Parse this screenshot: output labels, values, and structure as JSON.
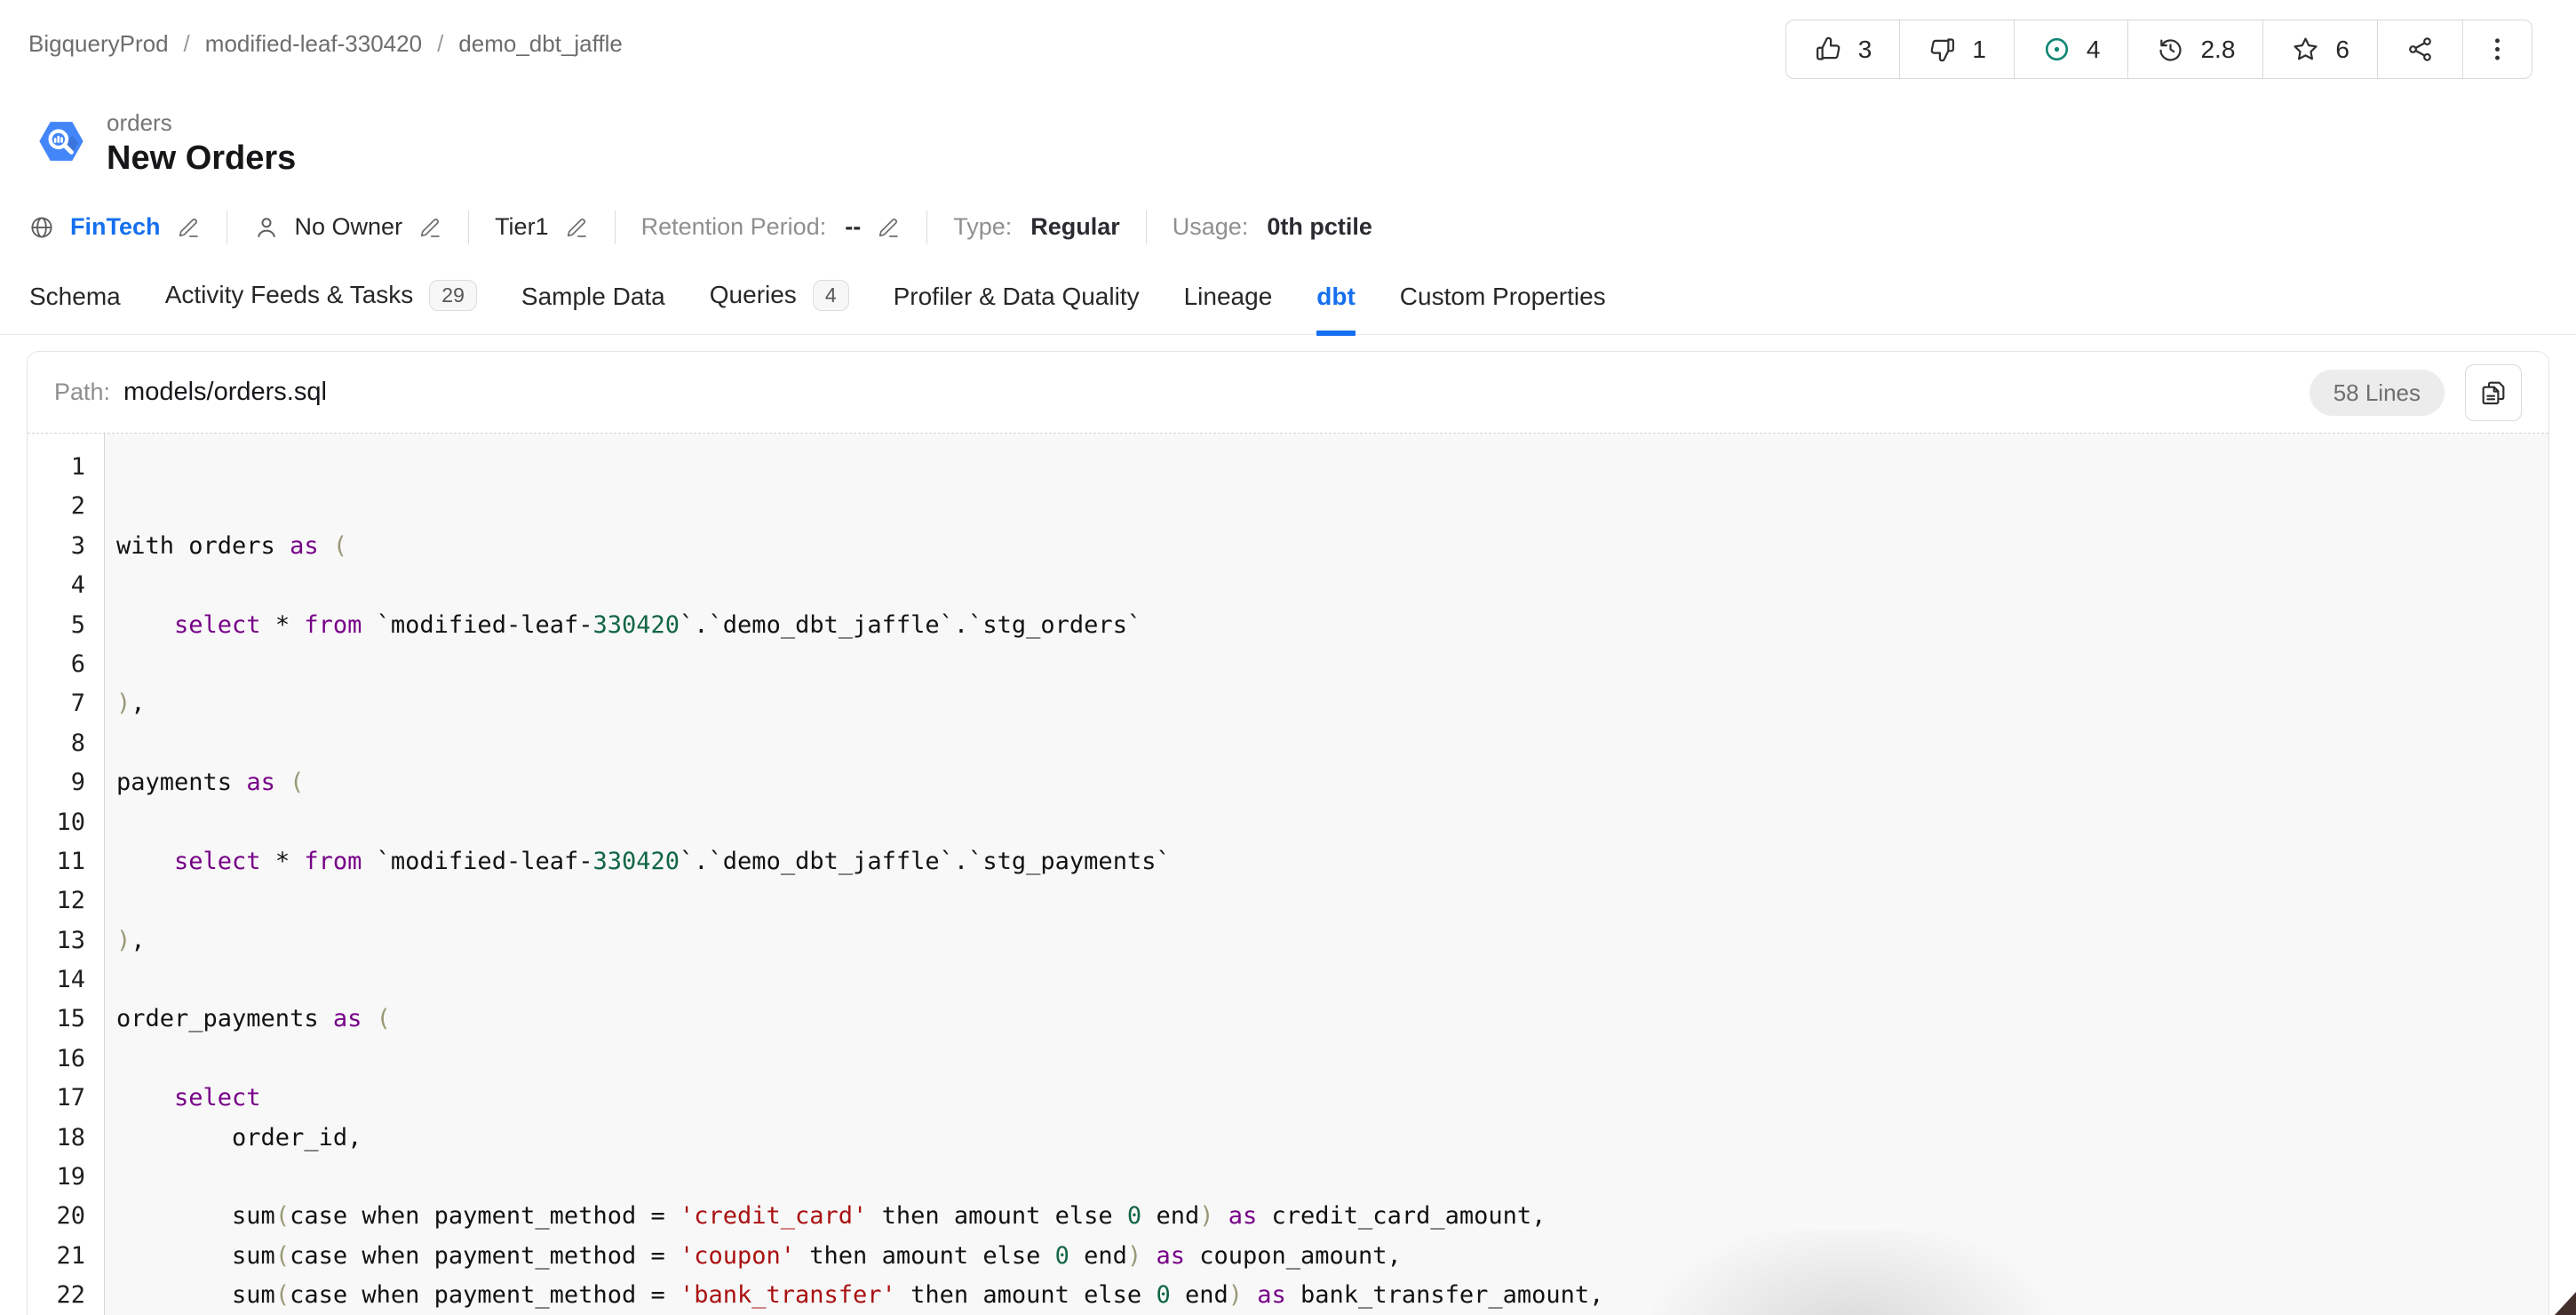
{
  "colors": {
    "accent": "#1570ef",
    "sql_keyword": "#770088",
    "sql_number": "#116644",
    "sql_string": "#aa1111",
    "sql_bracket": "#999977",
    "task_icon": "#0e8673",
    "bigquery_blue": "#4386fa"
  },
  "breadcrumb": {
    "separator": "/",
    "items": [
      "BigqueryProd",
      "modified-leaf-330420",
      "demo_dbt_jaffle"
    ]
  },
  "header": {
    "actions": [
      {
        "name": "upvote",
        "icon": "thumb-up-icon",
        "count": "3"
      },
      {
        "name": "downvote",
        "icon": "thumb-down-icon",
        "count": "1"
      },
      {
        "name": "tasks",
        "icon": "circle-dot-icon",
        "count": "4"
      },
      {
        "name": "version",
        "icon": "history-icon",
        "count": "2.8"
      },
      {
        "name": "follow",
        "icon": "star-icon",
        "count": "6"
      },
      {
        "name": "share",
        "icon": "share-icon"
      },
      {
        "name": "more",
        "icon": "kebab-icon"
      }
    ]
  },
  "entity": {
    "icon": "bigquery-icon",
    "type_label": "orders",
    "title": "New Orders"
  },
  "meta": {
    "items": [
      {
        "name": "domain",
        "icon": "globe-icon",
        "text": "FinTech",
        "link": true,
        "editable": true
      },
      {
        "name": "owner",
        "icon": "user-icon",
        "text": "No Owner",
        "editable": true
      },
      {
        "name": "tier",
        "text": "Tier1",
        "editable": true
      },
      {
        "name": "retention",
        "label": "Retention Period:",
        "value": "--",
        "editable": true
      },
      {
        "name": "type",
        "label": "Type:",
        "value": "Regular"
      },
      {
        "name": "usage",
        "label": "Usage:",
        "value": "0th pctile"
      }
    ]
  },
  "tabs": {
    "items": [
      {
        "label": "Schema"
      },
      {
        "label": "Activity Feeds & Tasks",
        "badge": "29"
      },
      {
        "label": "Sample Data"
      },
      {
        "label": "Queries",
        "badge": "4"
      },
      {
        "label": "Profiler & Data Quality"
      },
      {
        "label": "Lineage"
      },
      {
        "label": "dbt",
        "active": true
      },
      {
        "label": "Custom Properties"
      }
    ]
  },
  "code_panel": {
    "path_label": "Path:",
    "path": "models/orders.sql",
    "lines_badge": "58 Lines",
    "copy_icon": "copy-icon",
    "lines": [
      {
        "n": 1,
        "tokens": []
      },
      {
        "n": 2,
        "tokens": []
      },
      {
        "n": 3,
        "tokens": [
          [
            "plain",
            "with orders "
          ],
          [
            "keyword",
            "as"
          ],
          [
            "plain",
            " "
          ],
          [
            "bracket",
            "("
          ]
        ]
      },
      {
        "n": 4,
        "tokens": []
      },
      {
        "n": 5,
        "tokens": [
          [
            "plain",
            "    "
          ],
          [
            "keyword",
            "select"
          ],
          [
            "plain",
            " * "
          ],
          [
            "keyword",
            "from"
          ],
          [
            "plain",
            " `modified-leaf-"
          ],
          [
            "number",
            "330420"
          ],
          [
            "plain",
            "`.`demo_dbt_jaffle`.`stg_orders`"
          ]
        ]
      },
      {
        "n": 6,
        "tokens": []
      },
      {
        "n": 7,
        "tokens": [
          [
            "bracket",
            ")"
          ],
          [
            "plain",
            ","
          ]
        ]
      },
      {
        "n": 8,
        "tokens": []
      },
      {
        "n": 9,
        "tokens": [
          [
            "plain",
            "payments "
          ],
          [
            "keyword",
            "as"
          ],
          [
            "plain",
            " "
          ],
          [
            "bracket",
            "("
          ]
        ]
      },
      {
        "n": 10,
        "tokens": []
      },
      {
        "n": 11,
        "tokens": [
          [
            "plain",
            "    "
          ],
          [
            "keyword",
            "select"
          ],
          [
            "plain",
            " * "
          ],
          [
            "keyword",
            "from"
          ],
          [
            "plain",
            " `modified-leaf-"
          ],
          [
            "number",
            "330420"
          ],
          [
            "plain",
            "`.`demo_dbt_jaffle`.`stg_payments`"
          ]
        ]
      },
      {
        "n": 12,
        "tokens": []
      },
      {
        "n": 13,
        "tokens": [
          [
            "bracket",
            ")"
          ],
          [
            "plain",
            ","
          ]
        ]
      },
      {
        "n": 14,
        "tokens": []
      },
      {
        "n": 15,
        "tokens": [
          [
            "plain",
            "order_payments "
          ],
          [
            "keyword",
            "as"
          ],
          [
            "plain",
            " "
          ],
          [
            "bracket",
            "("
          ]
        ]
      },
      {
        "n": 16,
        "tokens": []
      },
      {
        "n": 17,
        "tokens": [
          [
            "plain",
            "    "
          ],
          [
            "keyword",
            "select"
          ]
        ]
      },
      {
        "n": 18,
        "tokens": [
          [
            "plain",
            "        order_id,"
          ]
        ]
      },
      {
        "n": 19,
        "tokens": []
      },
      {
        "n": 20,
        "tokens": [
          [
            "plain",
            "        sum"
          ],
          [
            "bracket",
            "("
          ],
          [
            "plain",
            "case when payment_method = "
          ],
          [
            "string",
            "'credit_card'"
          ],
          [
            "plain",
            " then amount else "
          ],
          [
            "number",
            "0"
          ],
          [
            "plain",
            " end"
          ],
          [
            "bracket",
            ")"
          ],
          [
            "plain",
            " "
          ],
          [
            "keyword",
            "as"
          ],
          [
            "plain",
            " credit_card_amount,"
          ]
        ]
      },
      {
        "n": 21,
        "tokens": [
          [
            "plain",
            "        sum"
          ],
          [
            "bracket",
            "("
          ],
          [
            "plain",
            "case when payment_method = "
          ],
          [
            "string",
            "'coupon'"
          ],
          [
            "plain",
            " then amount else "
          ],
          [
            "number",
            "0"
          ],
          [
            "plain",
            " end"
          ],
          [
            "bracket",
            ")"
          ],
          [
            "plain",
            " "
          ],
          [
            "keyword",
            "as"
          ],
          [
            "plain",
            " coupon_amount,"
          ]
        ]
      },
      {
        "n": 22,
        "tokens": [
          [
            "plain",
            "        sum"
          ],
          [
            "bracket",
            "("
          ],
          [
            "plain",
            "case when payment_method = "
          ],
          [
            "string",
            "'bank_transfer'"
          ],
          [
            "plain",
            " then amount else "
          ],
          [
            "number",
            "0"
          ],
          [
            "plain",
            " end"
          ],
          [
            "bracket",
            ")"
          ],
          [
            "plain",
            " "
          ],
          [
            "keyword",
            "as"
          ],
          [
            "plain",
            " bank_transfer_amount,"
          ]
        ]
      }
    ]
  }
}
